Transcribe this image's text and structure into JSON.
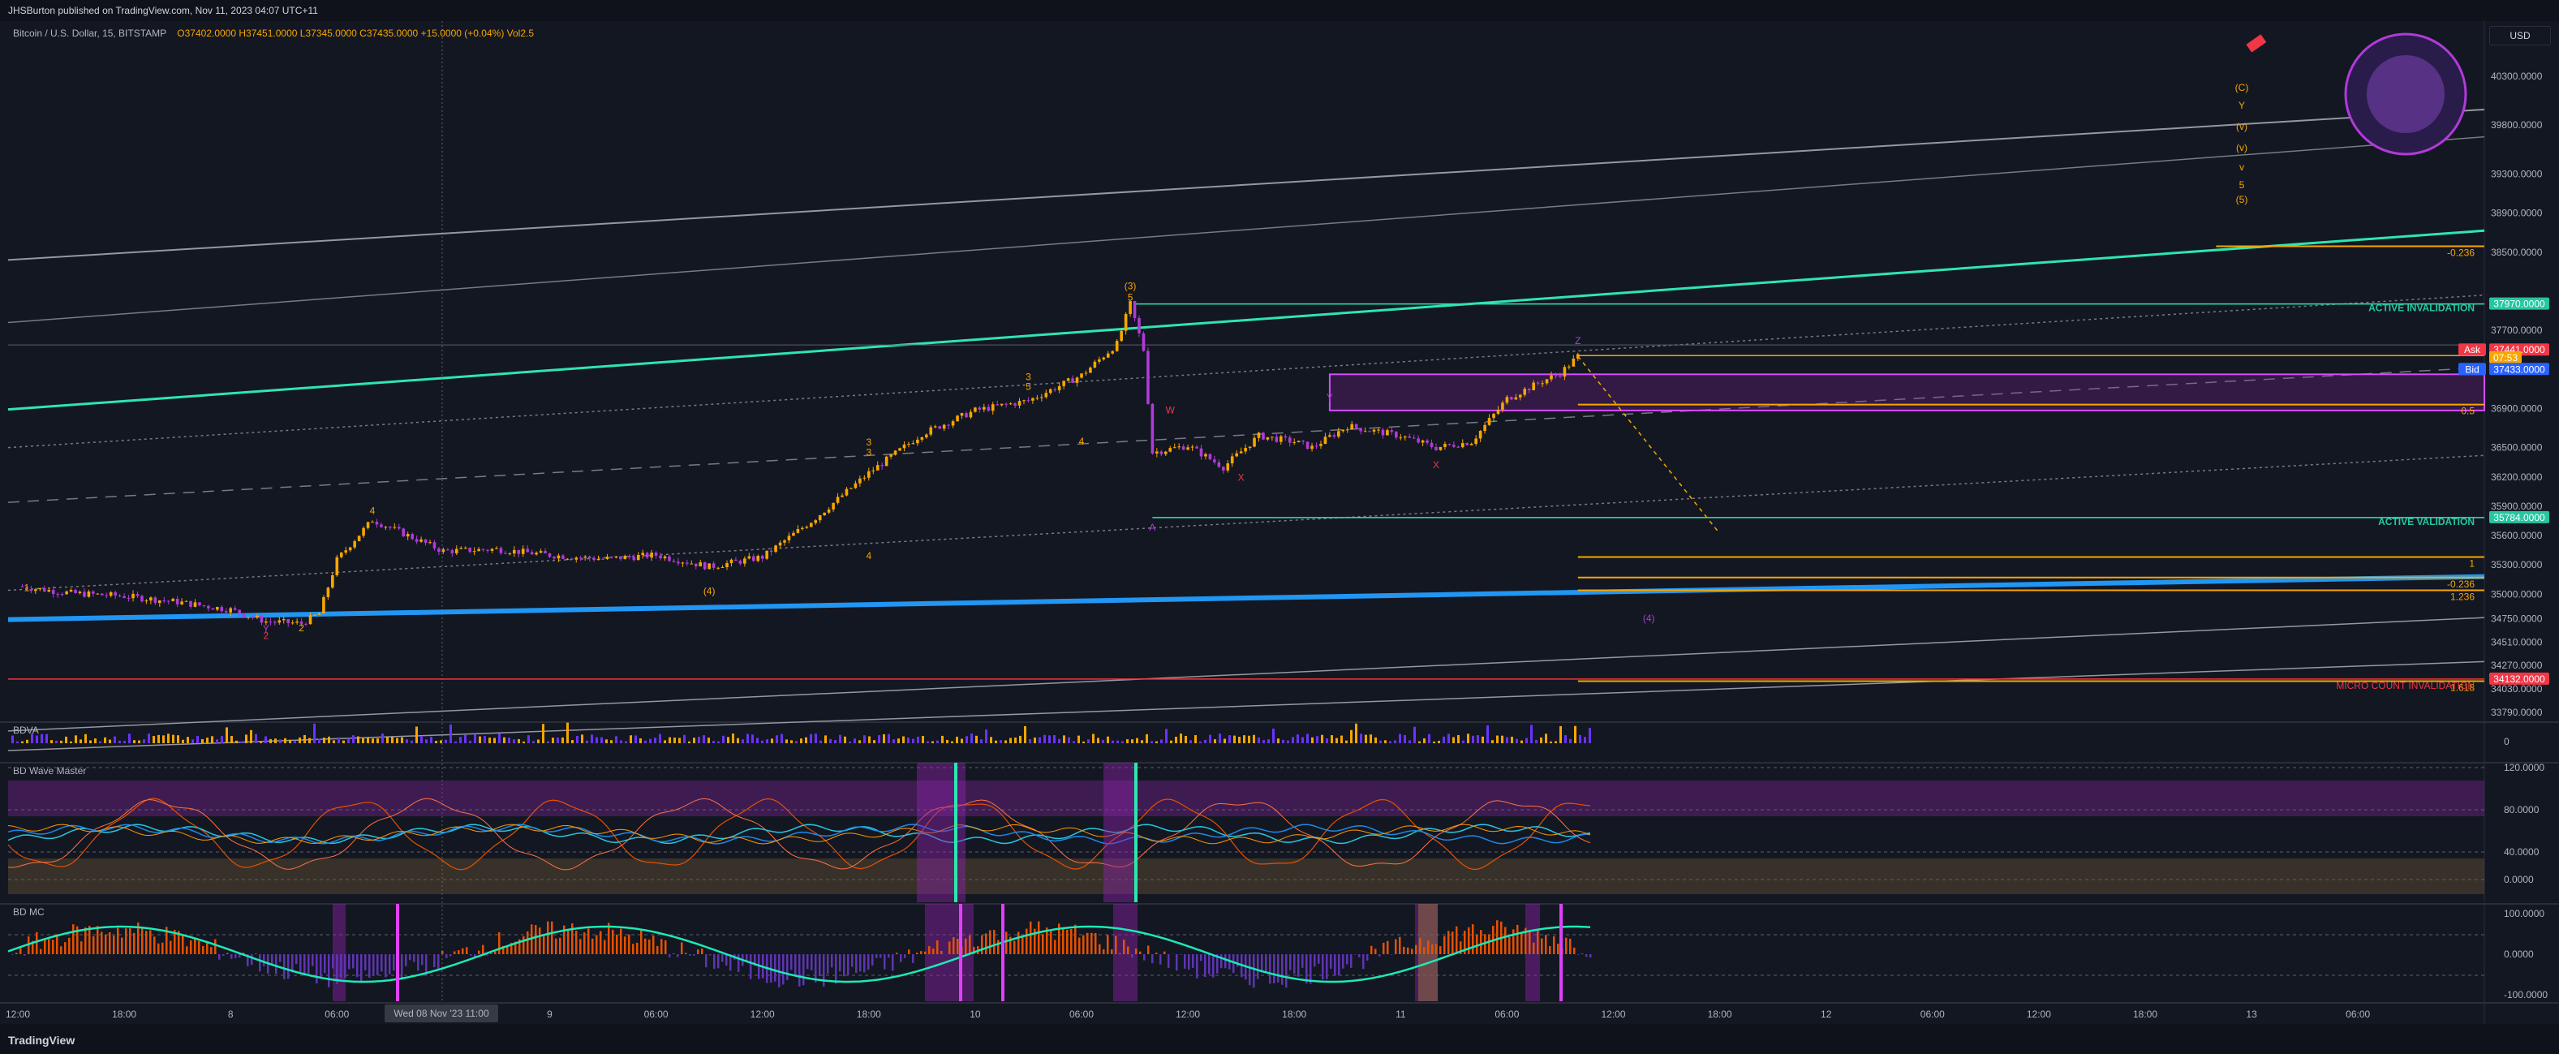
{
  "header": {
    "published": "JHSBurton published on TradingView.com, Nov 11, 2023 04:07 UTC+11"
  },
  "info": {
    "symbol": "Bitcoin / U.S. Dollar, 15, BITSTAMP",
    "ohlc": "O37402.0000  H37451.0000  L37345.0000  C37435.0000  +15.0000 (+0.04%)  Vol2.5"
  },
  "currency_button": "USD",
  "footer": {
    "brand": "TradingView"
  },
  "colors": {
    "background": "#131722",
    "up_candle": "#f7a600",
    "down_candle": "#b13ad9",
    "channel_main": "#2ee6b0",
    "channel_blue": "#2196f3",
    "invalidation_red": "#f23645",
    "zone_purple": "#8e24aa"
  },
  "price_scale": {
    "labels": [
      "40300.0000",
      "39800.0000",
      "39300.0000",
      "38900.0000",
      "38500.0000",
      "37700.0000",
      "36900.0000",
      "36500.0000",
      "36200.0000",
      "35900.0000",
      "35600.0000",
      "35300.0000",
      "35000.0000",
      "34750.0000",
      "34510.0000",
      "34270.0000",
      "34030.0000",
      "33790.0000"
    ],
    "tags": [
      {
        "text": "37970.0000",
        "color": "#26c6a0"
      },
      {
        "text": "Ask",
        "color": "#f23645"
      },
      {
        "text": "37441.0000",
        "color": "#f23645"
      },
      {
        "text": "07:53",
        "color": "#f7a600"
      },
      {
        "text": "Bid",
        "color": "#2962ff"
      },
      {
        "text": "37433.0000",
        "color": "#2962ff"
      },
      {
        "text": "35784.0000",
        "color": "#26c6a0"
      },
      {
        "text": "34132.0000",
        "color": "#f23645"
      }
    ]
  },
  "annotations": {
    "active_invalidation": "ACTIVE INVALIDATION",
    "active_validation": "ACTIVE VALIDATION",
    "micro_count_invalidation": "MICRO COUNT INVALIDATION",
    "fib_labels": [
      "-0.236",
      "0.5",
      "1",
      "-0.236",
      "1.236",
      "1.618"
    ],
    "wave_labels": [
      {
        "text": "(4)",
        "color": "#b13ad9"
      },
      {
        "text": "(C)",
        "color": "#f7a600"
      },
      {
        "text": "Y",
        "color": "#f7a600"
      },
      {
        "text": "(v)",
        "color": "#f7a600"
      },
      {
        "text": "(v)",
        "color": "#f7a600"
      },
      {
        "text": "v",
        "color": "#f7a600"
      },
      {
        "text": "5",
        "color": "#f7a600"
      },
      {
        "text": "(5)",
        "color": "#f7a600"
      },
      {
        "text": "(3)",
        "color": "#f7a600"
      },
      {
        "text": "5",
        "color": "#f7a600"
      },
      {
        "text": "3",
        "color": "#f7a600"
      },
      {
        "text": "5",
        "color": "#f7a600"
      },
      {
        "text": "4",
        "color": "#f7a600"
      },
      {
        "text": "W",
        "color": "#f23645"
      },
      {
        "text": "X",
        "color": "#f23645"
      },
      {
        "text": "Y",
        "color": "#b13ad9"
      },
      {
        "text": "X",
        "color": "#f23645"
      },
      {
        "text": "A",
        "color": "#b13ad9"
      },
      {
        "text": "Z",
        "color": "#b13ad9"
      },
      {
        "text": "3",
        "color": "#f7a600"
      },
      {
        "text": "4",
        "color": "#f7a600"
      },
      {
        "text": "(4)",
        "color": "#f7a600"
      },
      {
        "text": "4",
        "color": "#f7a600"
      },
      {
        "text": "2",
        "color": "#f23645"
      },
      {
        "text": "Y",
        "color": "#b13ad9"
      },
      {
        "text": "1",
        "color": "#f7a600"
      },
      {
        "text": "2",
        "color": "#f7a600"
      },
      {
        "text": "3",
        "color": "#f7a600"
      }
    ]
  },
  "panels": {
    "bdva": {
      "title": "BDVA",
      "scale": [
        "0"
      ]
    },
    "wave_master": {
      "title": "BD Wave Master",
      "scale": [
        "120.0000",
        "80.0000",
        "40.0000",
        "0.0000"
      ]
    },
    "mc": {
      "title": "BD MC",
      "scale": [
        "100.0000",
        "0.0000",
        "-100.0000"
      ]
    }
  },
  "time_axis": {
    "labels": [
      "12:00",
      "18:00",
      "8",
      "06:00",
      "18:00",
      "9",
      "06:00",
      "12:00",
      "18:00",
      "10",
      "06:00",
      "12:00",
      "18:00",
      "11",
      "06:00",
      "12:00",
      "18:00",
      "12",
      "06:00",
      "12:00",
      "18:00",
      "13",
      "06:00"
    ],
    "cursor_label": "Wed 08 Nov '23   11:00"
  },
  "chart_data": {
    "type": "candlestick",
    "title": "Bitcoin / U.S. Dollar, 15, BITSTAMP",
    "xlabel": "",
    "ylabel": "",
    "ylim": [
      33790,
      40300
    ],
    "last_candle": {
      "open": 37402,
      "high": 37451,
      "low": 37345,
      "close": 37435,
      "change": 15,
      "change_pct": 0.04,
      "volume": 2.5
    },
    "levels": {
      "active_invalidation": 37970,
      "ask": 37441,
      "bid": 37433,
      "active_validation": 35784,
      "micro_count_invalidation": 34132
    },
    "price_path": [
      [
        "11-07 12:00",
        35080
      ],
      [
        "11-07 15:00",
        35010
      ],
      [
        "11-07 18:00",
        34980
      ],
      [
        "11-07 21:00",
        34920
      ],
      [
        "11-08 00:00",
        34840
      ],
      [
        "11-08 02:00",
        34720
      ],
      [
        "11-08 04:00",
        34700
      ],
      [
        "11-08 05:00",
        34800
      ],
      [
        "11-08 06:00",
        35350
      ],
      [
        "11-08 07:00",
        35560
      ],
      [
        "11-08 08:00",
        35760
      ],
      [
        "11-08 10:00",
        35600
      ],
      [
        "11-08 12:00",
        35440
      ],
      [
        "11-08 15:00",
        35460
      ],
      [
        "11-08 18:00",
        35400
      ],
      [
        "11-08 21:00",
        35360
      ],
      [
        "11-09 00:00",
        35400
      ],
      [
        "11-09 03:00",
        35280
      ],
      [
        "11-09 06:00",
        35380
      ],
      [
        "11-09 09:00",
        35780
      ],
      [
        "11-09 12:00",
        36240
      ],
      [
        "11-09 15:00",
        36640
      ],
      [
        "11-09 18:00",
        36880
      ],
      [
        "11-09 21:00",
        36980
      ],
      [
        "11-10 00:00",
        37240
      ],
      [
        "11-10 02:00",
        37560
      ],
      [
        "11-10 02:45",
        37970
      ],
      [
        "11-10 03:30",
        37500
      ],
      [
        "11-10 04:00",
        36450
      ],
      [
        "11-10 06:00",
        36520
      ],
      [
        "11-10 08:00",
        36300
      ],
      [
        "11-10 10:00",
        36620
      ],
      [
        "11-10 12:00",
        36560
      ],
      [
        "11-10 13:00",
        36500
      ],
      [
        "11-10 15:00",
        36720
      ],
      [
        "11-10 18:00",
        36620
      ],
      [
        "11-10 20:00",
        36500
      ],
      [
        "11-10 22:00",
        36560
      ],
      [
        "11-11 00:00",
        37000
      ],
      [
        "11-11 02:00",
        37180
      ],
      [
        "11-11 03:00",
        37260
      ],
      [
        "11-11 04:00",
        37435
      ]
    ],
    "projection": [
      [
        "11-11 04:00",
        37435
      ],
      [
        "11-11 12:00",
        35620
      ]
    ],
    "fib_levels": [
      {
        "label": "-0.236",
        "value": 38560
      },
      {
        "label": "0.5",
        "value": 36940
      },
      {
        "label": "1",
        "value": 35380
      },
      {
        "label": "-0.236",
        "value": 35170
      },
      {
        "label": "1.236",
        "value": 35040
      },
      {
        "label": "1.618",
        "value": 34110
      }
    ],
    "grid": true,
    "legend": "none"
  }
}
